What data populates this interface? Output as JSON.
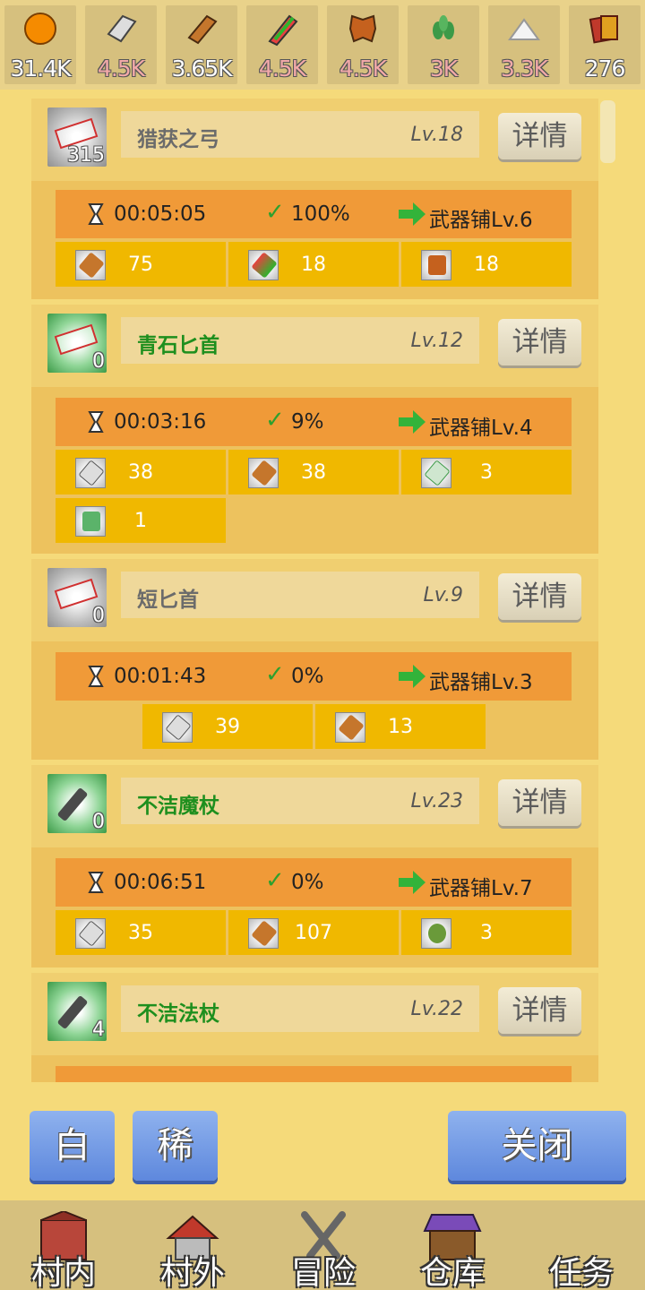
{
  "resources": [
    {
      "icon": "gold-coin-icon",
      "value": "31.4K",
      "warn": false
    },
    {
      "icon": "iron-ingot-icon",
      "value": "4.5K",
      "warn": true
    },
    {
      "icon": "wood-log-icon",
      "value": "3.65K",
      "warn": false
    },
    {
      "icon": "crystal-icon",
      "value": "4.5K",
      "warn": true
    },
    {
      "icon": "leather-icon",
      "value": "4.5K",
      "warn": true
    },
    {
      "icon": "herb-icon",
      "value": "3K",
      "warn": true
    },
    {
      "icon": "powder-icon",
      "value": "3.3K",
      "warn": true
    },
    {
      "icon": "cards-icon",
      "value": "276",
      "warn": false
    }
  ],
  "recipes": [
    {
      "name": "猎获之弓",
      "level": "Lv.18",
      "name_color": "gray",
      "icon_bg": "gray",
      "owned": "315",
      "time": "00:05:05",
      "rate": "100%",
      "shop": "武器铺Lv.6",
      "materials": [
        {
          "icon": "wood-log-icon",
          "value": "75"
        },
        {
          "icon": "crystal-icon",
          "value": "18"
        },
        {
          "icon": "leather-icon",
          "value": "18"
        }
      ]
    },
    {
      "name": "青石匕首",
      "level": "Lv.12",
      "name_color": "green",
      "icon_bg": "green",
      "owned": "0",
      "time": "00:03:16",
      "rate": "9%",
      "shop": "武器铺Lv.4",
      "materials": [
        {
          "icon": "iron-ingot-icon",
          "value": "38"
        },
        {
          "icon": "wood-log-icon",
          "value": "38"
        },
        {
          "icon": "feather-icon",
          "value": "3"
        },
        {
          "icon": "green-stone-icon",
          "value": "1"
        }
      ]
    },
    {
      "name": "短匕首",
      "level": "Lv.9",
      "name_color": "gray",
      "icon_bg": "gray",
      "owned": "0",
      "time": "00:01:43",
      "rate": "0%",
      "shop": "武器铺Lv.3",
      "materials": [
        {
          "icon": "iron-ingot-icon",
          "value": "39"
        },
        {
          "icon": "wood-log-icon",
          "value": "13"
        }
      ]
    },
    {
      "name": "不洁魔杖",
      "level": "Lv.23",
      "name_color": "green",
      "icon_bg": "green",
      "owned": "0",
      "time": "00:06:51",
      "rate": "0%",
      "shop": "武器铺Lv.7",
      "materials": [
        {
          "icon": "iron-ingot-icon",
          "value": "35"
        },
        {
          "icon": "wood-log-icon",
          "value": "107"
        },
        {
          "icon": "slime-icon",
          "value": "3"
        }
      ]
    },
    {
      "name": "不洁法杖",
      "level": "Lv.22",
      "name_color": "green",
      "icon_bg": "green",
      "owned": "4",
      "time": "",
      "rate": "",
      "shop": "",
      "materials": []
    }
  ],
  "detail_label": "详情",
  "filter_buttons": {
    "white": "白",
    "rare": "稀"
  },
  "close_label": "关闭",
  "nav": [
    {
      "icon": "village-house-icon",
      "label": "村内"
    },
    {
      "icon": "outside-house-icon",
      "label": "村外"
    },
    {
      "icon": "crossed-swords-icon",
      "label": "冒险"
    },
    {
      "icon": "warehouse-icon",
      "label": "仓库"
    },
    {
      "icon": "quest-icon",
      "label": "任务"
    }
  ]
}
